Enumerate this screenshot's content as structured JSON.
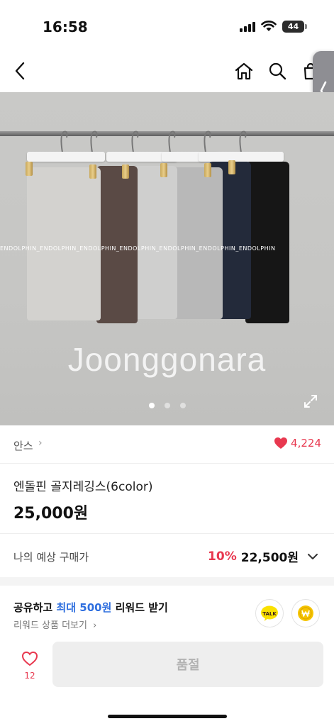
{
  "status_bar": {
    "time": "16:58",
    "battery": "44"
  },
  "hero": {
    "watermark": "Joonggonara",
    "brand_strip": "ENDOLPHIN_ENDOLPHIN_ENDOLPHIN_ENDOLPHIN_ENDOLPHIN_ENDOLPHIN_ENDOLPHIN",
    "page_indicator": {
      "total": 3,
      "active": 1
    },
    "legging_colors": [
      "#d3d2cf",
      "#5a4a45",
      "#cfcfce",
      "#b8b8b8",
      "#232a3a",
      "#161616"
    ]
  },
  "shop": {
    "name": "안스",
    "likes": "4,224"
  },
  "product": {
    "title": "엔돌핀 골지레깅스(6color)",
    "price": "25,000원"
  },
  "estimate": {
    "label": "나의 예상 구매가",
    "discount": "10%",
    "price": "22,500원"
  },
  "share": {
    "title_prefix": "공유하고 ",
    "title_highlight": "최대 500원",
    "title_suffix": " 리워드 받기",
    "link": "리워드 상품 더보기",
    "kakao_label": "TALK"
  },
  "bottom": {
    "wish_count": "12",
    "action_label": "품절"
  },
  "colors": {
    "accent": "#e8384f",
    "highlight_blue": "#2f6fdf",
    "kakao_yellow": "#fae100"
  }
}
